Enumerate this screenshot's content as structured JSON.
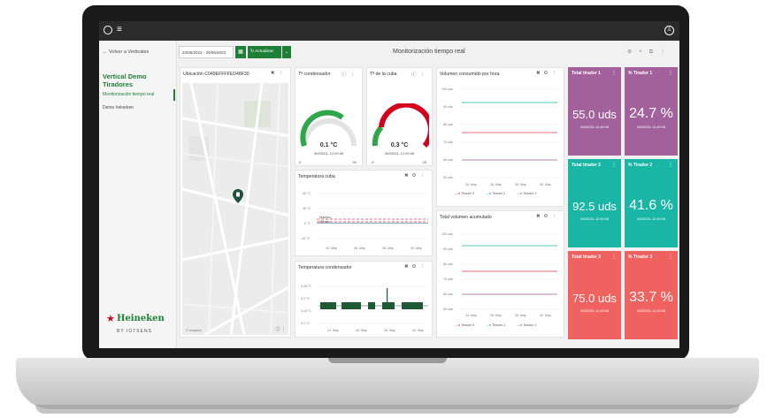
{
  "topbar": {
    "menu_icon": "hamburger-icon",
    "user_icon": "user-icon"
  },
  "sidebar": {
    "back_label": "Volver a Verticales",
    "title": "Vertical Demo Tiradores",
    "items": [
      {
        "label": "Monitorización tiempo real",
        "active": true
      },
      {
        "label": "Demo heineken",
        "active": false
      }
    ],
    "brand": {
      "name": "Heineken",
      "byline": "BY IOTSENS"
    }
  },
  "toolbar": {
    "date_range": "23/05/2023 - 30/05/2023",
    "update_label": "Actualizar",
    "page_title": "Monitorización tiempo real"
  },
  "map_card": {
    "title": "Ubicación C049EFFFFED48F30",
    "footer": "© mapbox"
  },
  "gauge1": {
    "title": "Tª condensador",
    "value": "0.1 °C",
    "date": "30/05/23, 12:49:08",
    "min": "0",
    "max": "90"
  },
  "gauge2": {
    "title": "Tª de la cuba",
    "value": "0.3 °C",
    "date": "30/05/23, 12:49:08",
    "min": "-5",
    "max": "25"
  },
  "temp_cuba": {
    "title": "Temperatura cuba",
    "y_labels": [
      "20 °C",
      "10 °C",
      "0 °C",
      "-10 °C"
    ],
    "x_labels": [
      "24. May",
      "26. May",
      "28. May",
      "30. May"
    ],
    "annotations": [
      "Máximo",
      "Mínimo"
    ]
  },
  "temp_cond": {
    "title": "Temperatura condensador",
    "y_labels": [
      "0.25 °C",
      "0.2 °C",
      "0.15 °C",
      "0.1 °C"
    ],
    "x_labels": [
      "24. May",
      "26. May",
      "28. May",
      "30. May"
    ]
  },
  "vol_hora": {
    "title": "Volumen consumido por hora",
    "y_labels": [
      "100 uds",
      "90 uds",
      "80 uds",
      "70 uds",
      "60 uds",
      "50 uds"
    ],
    "x_labels": [
      "24. May",
      "26. May",
      "28. May",
      "30. May"
    ],
    "legend": [
      "Tirador 3",
      "Tirador 2",
      "Tirador 1"
    ]
  },
  "vol_acum": {
    "title": "Total volumen acumulado",
    "y_labels": [
      "100 uds",
      "90 uds",
      "80 uds",
      "70 uds",
      "60 uds",
      "50 uds"
    ],
    "x_labels": [
      "24. May",
      "26. May",
      "28. May",
      "30. May"
    ],
    "legend": [
      "Tirador 3",
      "Tirador 2",
      "Tirador 1"
    ]
  },
  "kpis": [
    {
      "title": "Total tirador 1",
      "value": "55.0 uds",
      "date": "30/05/23, 12:49:08",
      "color": "#a2619b"
    },
    {
      "title": "% Tirador 1",
      "value": "24.7 %",
      "date": "30/05/23, 12:49:08",
      "color": "#a2619b"
    },
    {
      "title": "Total tirador 2",
      "value": "92.5 uds",
      "date": "30/05/23, 12:49:08",
      "color": "#19b6a6"
    },
    {
      "title": "% Tirador 2",
      "value": "41.6 %",
      "date": "30/05/23, 12:49:08",
      "color": "#19b6a6"
    },
    {
      "title": "Total tirador 3",
      "value": "75.0 uds",
      "date": "30/05/23, 12:49:08",
      "color": "#f0625f"
    },
    {
      "title": "% Tirador 3",
      "value": "33.7 %",
      "date": "30/05/23, 12:49:08",
      "color": "#f0625f"
    }
  ],
  "colors": {
    "brand_green": "#1e7f36",
    "series_red": "#e23b4a",
    "series_teal": "#19b6a6",
    "series_purple": "#a2619b"
  }
}
